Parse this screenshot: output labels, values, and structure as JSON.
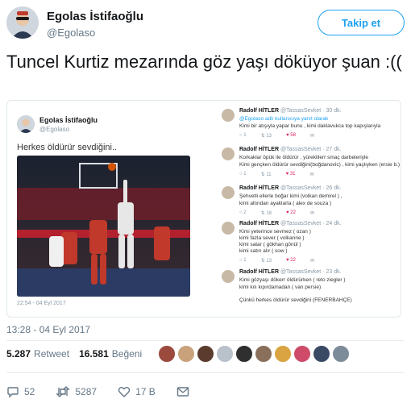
{
  "author": {
    "display_name": "Egolas İstifaoğlu",
    "handle": "@Egolaso"
  },
  "follow_button": "Takip et",
  "tweet_text": "Tuncel Kurtiz mezarında göz yaşı döküyor şuan :((",
  "embedded": {
    "name": "Egolas İstifaoğlu",
    "handle": "@Egolaso",
    "text": "Herkes öldürür sevdiğini..",
    "date": "22:54 - 04 Eyl 2017"
  },
  "replies": [
    {
      "name": "Radolf HİTLER",
      "meta": "@TassasSevket · 30 dk.",
      "lines": [
        "@Egolaso adlı kullanıcıya yanıt olarak",
        "Kimi bir atışıyla yapar bunu , kimi daklavukca top kapışlarıyla"
      ],
      "reply": "1",
      "retweet": "13",
      "like": "58"
    },
    {
      "name": "Radolf HİTLER",
      "meta": "@TassasSevket · 27 dk.",
      "lines": [
        "Korkaklar öpük ile öldürür , yüreklilerr smaç darbeleriyle",
        "Kimi gençken öldürür sevdiğini(boğdanovic) , kimi yaşlıyken (ersie b.)"
      ],
      "reply": "1",
      "retweet": "11",
      "like": "31"
    },
    {
      "name": "Radolf HİTLER",
      "meta": "@TassasSevket · 26 dk.",
      "lines": [
        "Şehvetli ellerle boğar kimi (volkan demirel ) ,",
        "kimi altından ayaklarla ( alex de souza )"
      ],
      "reply": "2",
      "retweet": "18",
      "like": "22"
    },
    {
      "name": "Radolf HİTLER",
      "meta": "@TassasSevket · 24 dk.",
      "lines": [
        "Kimi yeterince sevmez ( ozan )",
        "kimi fazla sever ( volkanne )",
        "kimi satar ( gökhan gönül )",
        "kimi satın alır ( sow )"
      ],
      "reply": "1",
      "retweet": "13",
      "like": "22"
    },
    {
      "name": "Radolf HİTLER",
      "meta": "@TassasSevket · 23 dk.",
      "lines": [
        "Kimi gözyaşı dökerr öldürürken ( reto ziegler )",
        "kimi kılı kıpırdamadan ( van persie)",
        "",
        "Çünkü herkes öldürür sevdiğini (FENERBAHÇE)"
      ],
      "reply": "",
      "retweet": "",
      "like": ""
    }
  ],
  "timestamp": "13:28 - 04 Eyl 2017",
  "stats": {
    "retweets_count": "5.287",
    "retweets_label": "Retweet",
    "likes_count": "16.581",
    "likes_label": "Beğeni"
  },
  "liker_colors": [
    "#9c4a3e",
    "#c9a27c",
    "#5a3b2e",
    "#b9c2cb",
    "#2f2f2f",
    "#8a6f5a",
    "#d9a441",
    "#cf4b6a",
    "#3b4a64",
    "#7d8c99"
  ],
  "actions": {
    "reply_count": "52",
    "retweet_count": "5287",
    "like_count": "17 B"
  }
}
